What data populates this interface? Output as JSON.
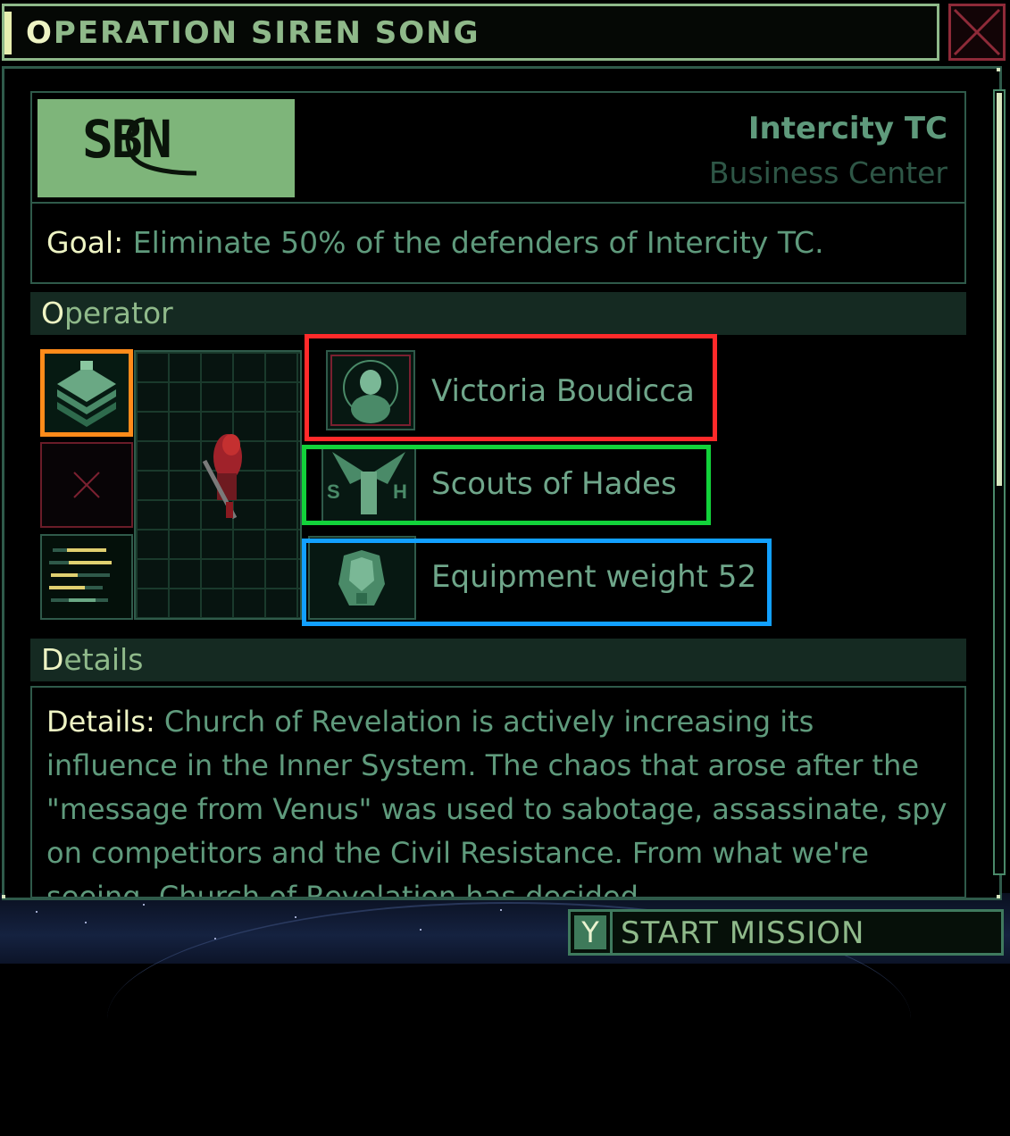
{
  "window": {
    "title": "OPERATION SIREN SONG",
    "close_icon": "close-x-icon"
  },
  "mission": {
    "logo_text": "SBN",
    "location_name": "Intercity TC",
    "location_type": "Business Center",
    "goal_label": "Goal:",
    "goal_text": "Eliminate 50% of the defenders of Intercity TC."
  },
  "operator": {
    "section_title": "Operator",
    "slots": [
      "stack-layers-icon",
      "empty-slot-x-icon",
      "stats-bars-icon"
    ],
    "rows": [
      {
        "icon": "operator-portrait-icon",
        "label": "Victoria Boudicca",
        "highlight": "#ff2a2a"
      },
      {
        "icon": "faction-emblem-icon",
        "label": "Scouts of Hades",
        "highlight": "#12d23a"
      },
      {
        "icon": "armor-icon",
        "label": "Equipment weight 52",
        "highlight": "#12a0ff"
      }
    ]
  },
  "details": {
    "section_title": "Details",
    "label": "Details:",
    "text": "Church of Revelation is actively increasing its influence in the Inner System. The chaos that arose after the \"message from Venus\" was used to sabotage, assassinate, spy on competitors and the Civil Resistance. From what we're seeing, Church of Revelation has decided"
  },
  "footer": {
    "key": "Y",
    "start_label": "START MISSION"
  },
  "colors": {
    "accent": "#8fb98a",
    "text_green": "#5f9a7c",
    "highlight_text": "#eef4c4",
    "border": "#2f5a4a"
  }
}
